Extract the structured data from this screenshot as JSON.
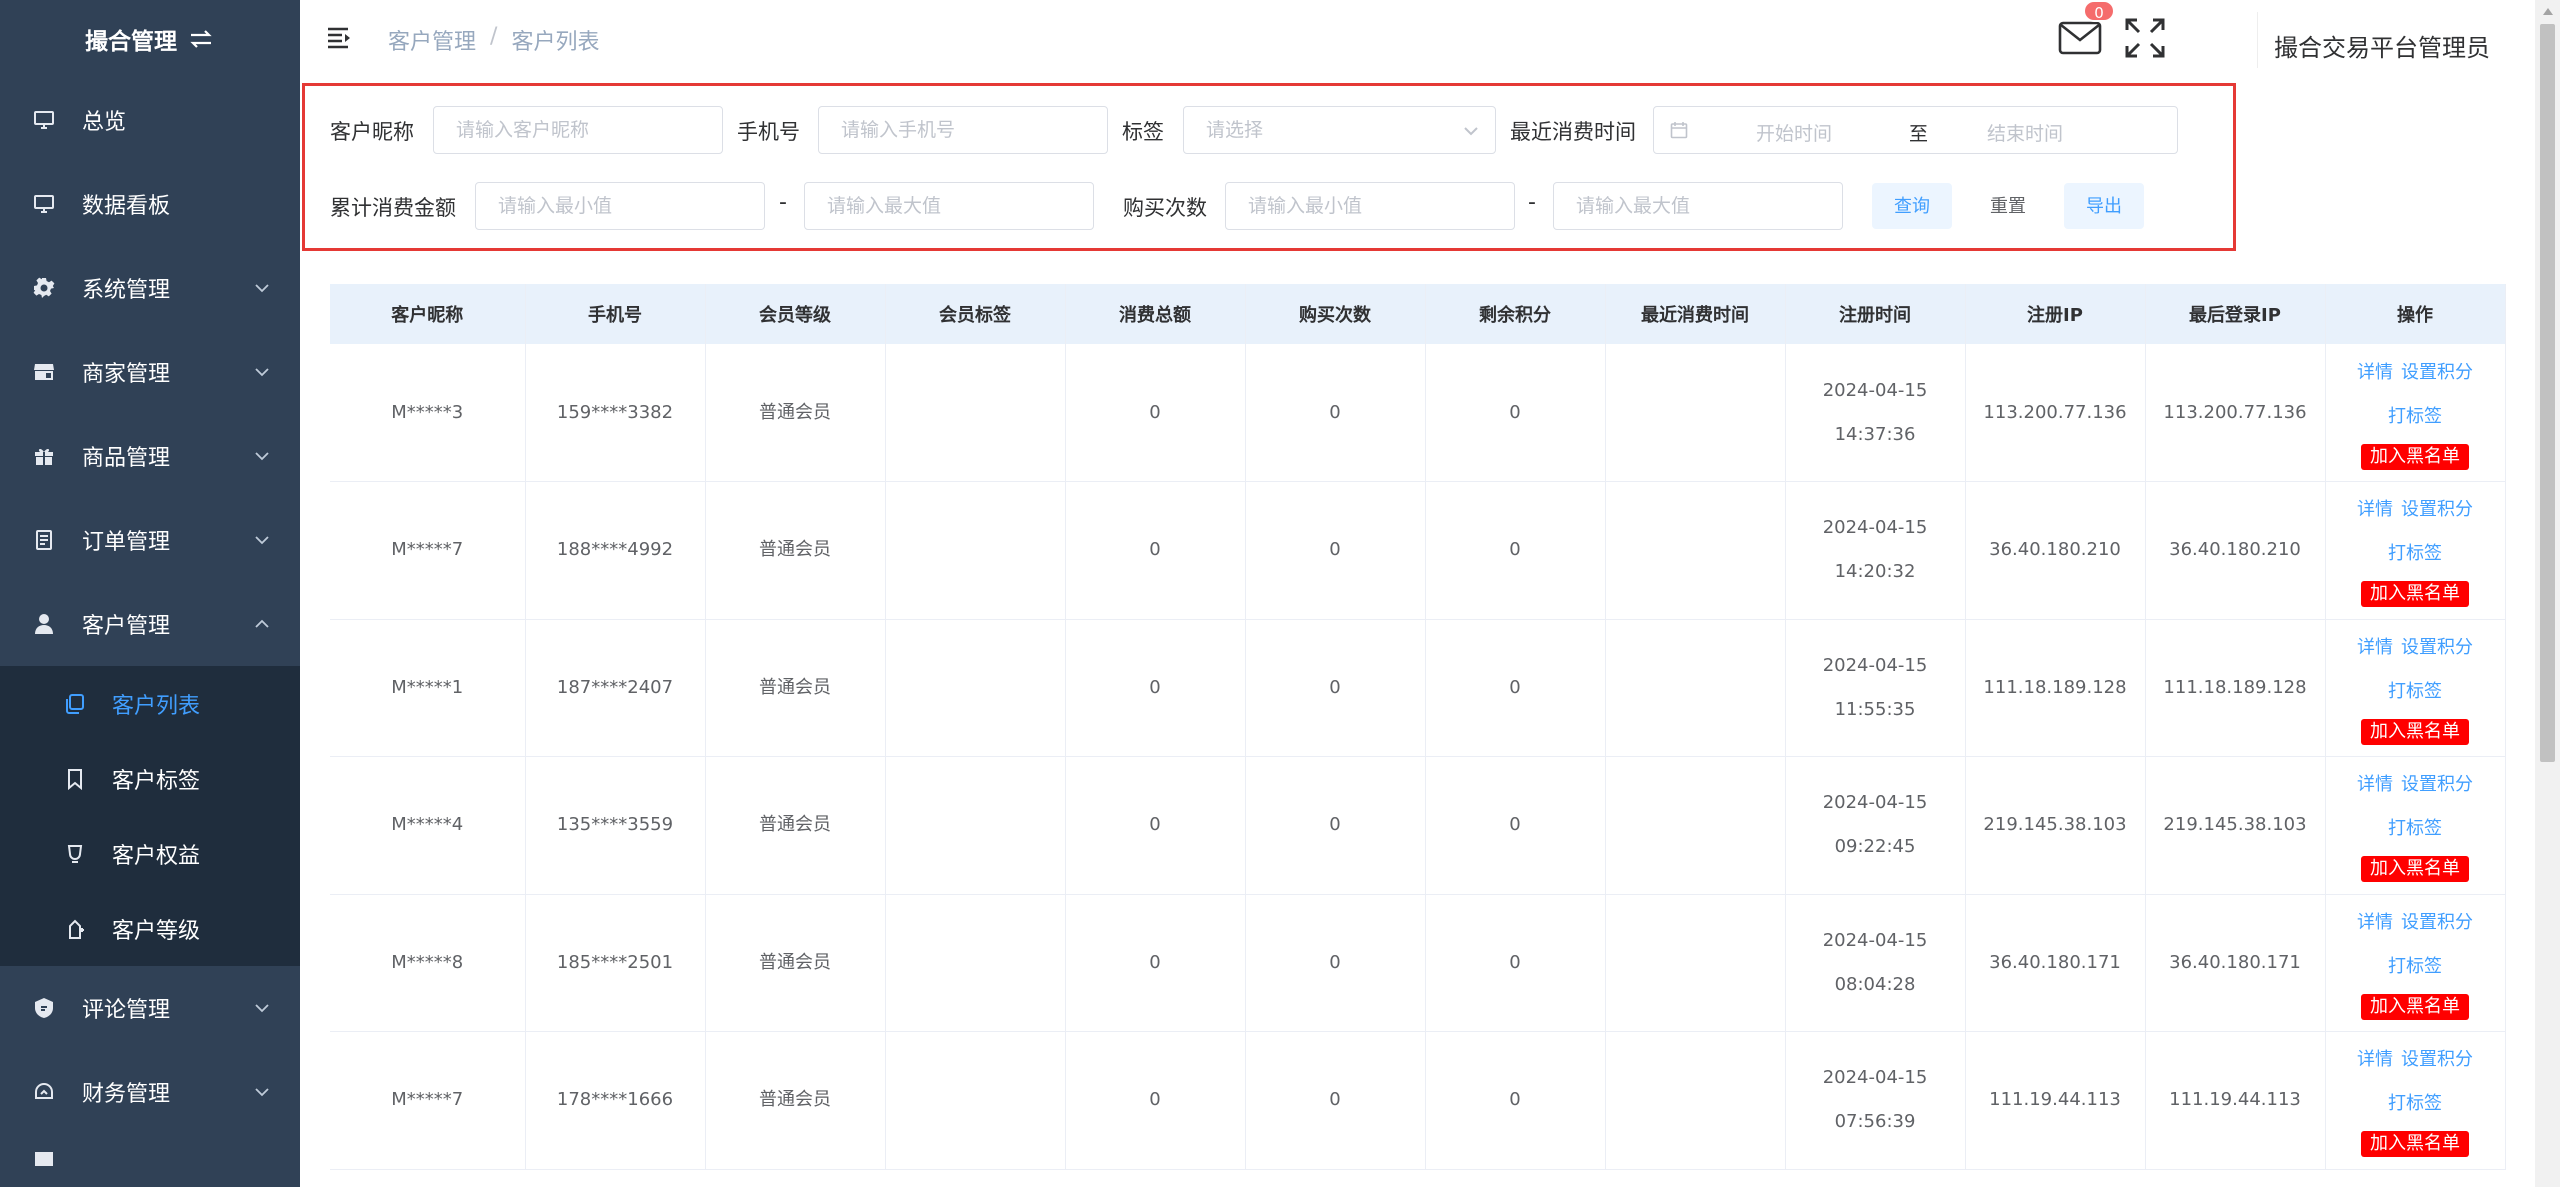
{
  "sidebar": {
    "brand": "撮合管理",
    "items": [
      {
        "label": "总览",
        "icon": "monitor-icon",
        "expandable": false
      },
      {
        "label": "数据看板",
        "icon": "monitor-icon",
        "expandable": false
      },
      {
        "label": "系统管理",
        "icon": "gear-icon",
        "expandable": true
      },
      {
        "label": "商家管理",
        "icon": "store-icon",
        "expandable": true
      },
      {
        "label": "商品管理",
        "icon": "gift-icon",
        "expandable": true
      },
      {
        "label": "订单管理",
        "icon": "document-icon",
        "expandable": true
      },
      {
        "label": "客户管理",
        "icon": "user-icon",
        "expandable": true,
        "expanded": true
      }
    ],
    "sub_items": [
      {
        "label": "客户列表",
        "icon": "copy-icon",
        "active": true
      },
      {
        "label": "客户标签",
        "icon": "bookmark-icon",
        "active": false
      },
      {
        "label": "客户权益",
        "icon": "cup-icon",
        "active": false
      },
      {
        "label": "客户等级",
        "icon": "level-icon",
        "active": false
      }
    ],
    "items_after": [
      {
        "label": "评论管理",
        "icon": "shield-icon",
        "expandable": true
      },
      {
        "label": "财务管理",
        "icon": "wallet-icon",
        "expandable": true
      }
    ]
  },
  "header": {
    "breadcrumb": [
      "客户管理",
      "客户列表"
    ],
    "mail_badge": "0",
    "admin_name": "撮合交易平台管理员"
  },
  "filter": {
    "nickname_label": "客户昵称",
    "nickname_placeholder": "请输入客户昵称",
    "phone_label": "手机号",
    "phone_placeholder": "请输入手机号",
    "tag_label": "标签",
    "tag_placeholder": "请选择",
    "last_purchase_label": "最近消费时间",
    "start_placeholder": "开始时间",
    "range_sep": "至",
    "end_placeholder": "结束时间",
    "total_amount_label": "累计消费金额",
    "min_placeholder": "请输入最小值",
    "max_placeholder": "请输入最大值",
    "dash": "-",
    "purchase_count_label": "购买次数",
    "query_button": "查询",
    "reset_button": "重置",
    "export_button": "导出"
  },
  "table": {
    "columns": [
      "客户昵称",
      "手机号",
      "会员等级",
      "会员标签",
      "消费总额",
      "购买次数",
      "剩余积分",
      "最近消费时间",
      "注册时间",
      "注册IP",
      "最后登录IP",
      "操作"
    ],
    "actions": {
      "detail": "详情",
      "set_points": "设置积分",
      "tag": "打标签",
      "blacklist": "加入黑名单"
    },
    "rows": [
      {
        "nickname": "M*****3",
        "phone": "159****3382",
        "level": "普通会员",
        "tags": "",
        "total": "0",
        "count": "0",
        "points": "0",
        "last": "",
        "reg_time": "2024-04-15 14:37:36",
        "reg_ip": "113.200.77.136",
        "login_ip": "113.200.77.136"
      },
      {
        "nickname": "M*****7",
        "phone": "188****4992",
        "level": "普通会员",
        "tags": "",
        "total": "0",
        "count": "0",
        "points": "0",
        "last": "",
        "reg_time": "2024-04-15 14:20:32",
        "reg_ip": "36.40.180.210",
        "login_ip": "36.40.180.210"
      },
      {
        "nickname": "M*****1",
        "phone": "187****2407",
        "level": "普通会员",
        "tags": "",
        "total": "0",
        "count": "0",
        "points": "0",
        "last": "",
        "reg_time": "2024-04-15 11:55:35",
        "reg_ip": "111.18.189.128",
        "login_ip": "111.18.189.128"
      },
      {
        "nickname": "M*****4",
        "phone": "135****3559",
        "level": "普通会员",
        "tags": "",
        "total": "0",
        "count": "0",
        "points": "0",
        "last": "",
        "reg_time": "2024-04-15 09:22:45",
        "reg_ip": "219.145.38.103",
        "login_ip": "219.145.38.103"
      },
      {
        "nickname": "M*****8",
        "phone": "185****2501",
        "level": "普通会员",
        "tags": "",
        "total": "0",
        "count": "0",
        "points": "0",
        "last": "",
        "reg_time": "2024-04-15 08:04:28",
        "reg_ip": "36.40.180.171",
        "login_ip": "36.40.180.171"
      },
      {
        "nickname": "M*****7",
        "phone": "178****1666",
        "level": "普通会员",
        "tags": "",
        "total": "0",
        "count": "0",
        "points": "0",
        "last": "",
        "reg_time": "2024-04-15 07:56:39",
        "reg_ip": "111.19.44.113",
        "login_ip": "111.19.44.113"
      }
    ]
  },
  "colors": {
    "sidebar_bg": "#304156",
    "submenu_bg": "#1f2d3d",
    "accent": "#409eff",
    "danger": "#ff0000",
    "highlight_border": "#e53935"
  }
}
